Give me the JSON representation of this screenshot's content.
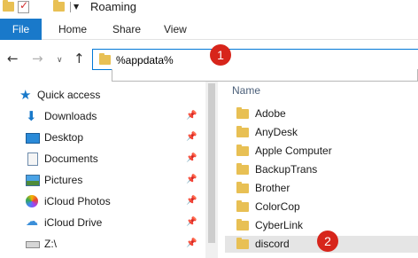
{
  "window": {
    "title": "Roaming"
  },
  "ribbon": {
    "file": "File",
    "tabs": [
      "Home",
      "Share",
      "View"
    ]
  },
  "address": {
    "value": "%appdata%"
  },
  "badges": [
    "1",
    "2"
  ],
  "nav_pane": {
    "items": [
      {
        "label": "Quick access",
        "icon": "star-icon",
        "pinned": false
      },
      {
        "label": "Downloads",
        "icon": "download-icon",
        "pinned": true
      },
      {
        "label": "Desktop",
        "icon": "desktop-icon",
        "pinned": true
      },
      {
        "label": "Documents",
        "icon": "documents-icon",
        "pinned": true
      },
      {
        "label": "Pictures",
        "icon": "pictures-icon",
        "pinned": true
      },
      {
        "label": "iCloud Photos",
        "icon": "icloud-photos-icon",
        "pinned": true
      },
      {
        "label": "iCloud Drive",
        "icon": "icloud-drive-icon",
        "pinned": true
      },
      {
        "label": "Z:\\",
        "icon": "network-drive-icon",
        "pinned": true
      }
    ]
  },
  "content": {
    "column_header": "Name",
    "folders": [
      "Adobe",
      "AnyDesk",
      "Apple Computer",
      "BackupTrans",
      "Brother",
      "ColorCop",
      "CyberLink",
      "discord"
    ],
    "selected": "discord"
  },
  "colors": {
    "accent": "#1979ca",
    "folder": "#e8c054",
    "badge": "#d7251b",
    "selection": "#e5e5e5"
  }
}
